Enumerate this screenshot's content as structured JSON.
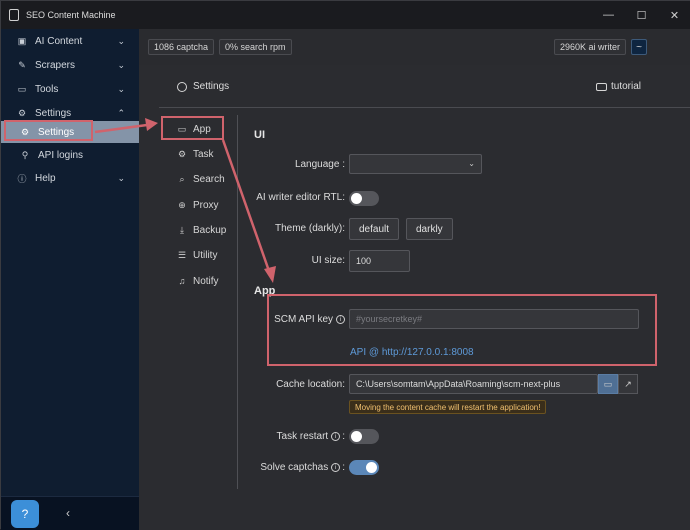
{
  "window": {
    "title": "SEO Content Machine",
    "controls": {
      "minimize": "—",
      "maximize": "☐",
      "close": "✕"
    }
  },
  "sidebar": {
    "items": [
      {
        "label": "AI Content",
        "icon": "image-icon",
        "glyph": "▣",
        "chevron": "⌄"
      },
      {
        "label": "Scrapers",
        "icon": "edit-icon",
        "glyph": "✎",
        "chevron": "⌄"
      },
      {
        "label": "Tools",
        "icon": "briefcase-icon",
        "glyph": "▭",
        "chevron": "⌄"
      },
      {
        "label": "Settings",
        "icon": "gear-icon",
        "glyph": "⚙",
        "chevron": "⌃"
      },
      {
        "label": "Settings",
        "icon": "gear-icon",
        "glyph": "⚙",
        "active": true
      },
      {
        "label": "API logins",
        "icon": "person-icon",
        "glyph": "⚲"
      },
      {
        "label": "Help",
        "icon": "info-icon",
        "glyph": "ⓘ",
        "chevron": "⌄"
      }
    ],
    "help_fab_icon": "chat-help-icon",
    "help_fab_glyph": "?",
    "collapse_glyph": "‹"
  },
  "topbar": {
    "captcha": "1086 captcha",
    "search_rpm": "0% search rpm",
    "ai_writer": "2960K ai writer",
    "tilde": "~"
  },
  "panel": {
    "header": "Settings",
    "tutorial": "tutorial",
    "subnav": [
      {
        "label": "App",
        "icon": "monitor-icon",
        "glyph": "▭"
      },
      {
        "label": "Task",
        "icon": "gear-icon",
        "glyph": "⚙"
      },
      {
        "label": "Search",
        "icon": "search-icon",
        "glyph": "⌕"
      },
      {
        "label": "Proxy",
        "icon": "globe-icon",
        "glyph": "⊕"
      },
      {
        "label": "Backup",
        "icon": "download-icon",
        "glyph": "⤓"
      },
      {
        "label": "Utility",
        "icon": "layers-icon",
        "glyph": "☰"
      },
      {
        "label": "Notify",
        "icon": "bell-icon",
        "glyph": "♫"
      }
    ],
    "ui_section": "UI",
    "language_label": "Language :",
    "language_value": "",
    "rtl_label": "AI writer editor RTL:",
    "theme_label": "Theme (darkly):",
    "theme_default": "default",
    "theme_darkly": "darkly",
    "ui_size_label": "UI size:",
    "ui_size_value": "100",
    "app_section": "App",
    "api_key_label": "SCM API key",
    "api_key_placeholder": "#yoursecretkey#",
    "api_link": "API @ http://127.0.0.1:8008",
    "cache_label": "Cache location:",
    "cache_value": "C:\\Users\\somtam\\AppData\\Roaming\\scm-next-plus",
    "cache_warning": "Moving the content cache will restart the application!",
    "task_restart_label": "Task restart",
    "solve_captchas_label": "Solve captchas",
    "rtl_on": false,
    "task_restart_on": false,
    "solve_captchas_on": true
  },
  "colors": {
    "annotation": "#d0636c",
    "accent": "#5e9ad8",
    "sidebar": "#0f1d30"
  }
}
